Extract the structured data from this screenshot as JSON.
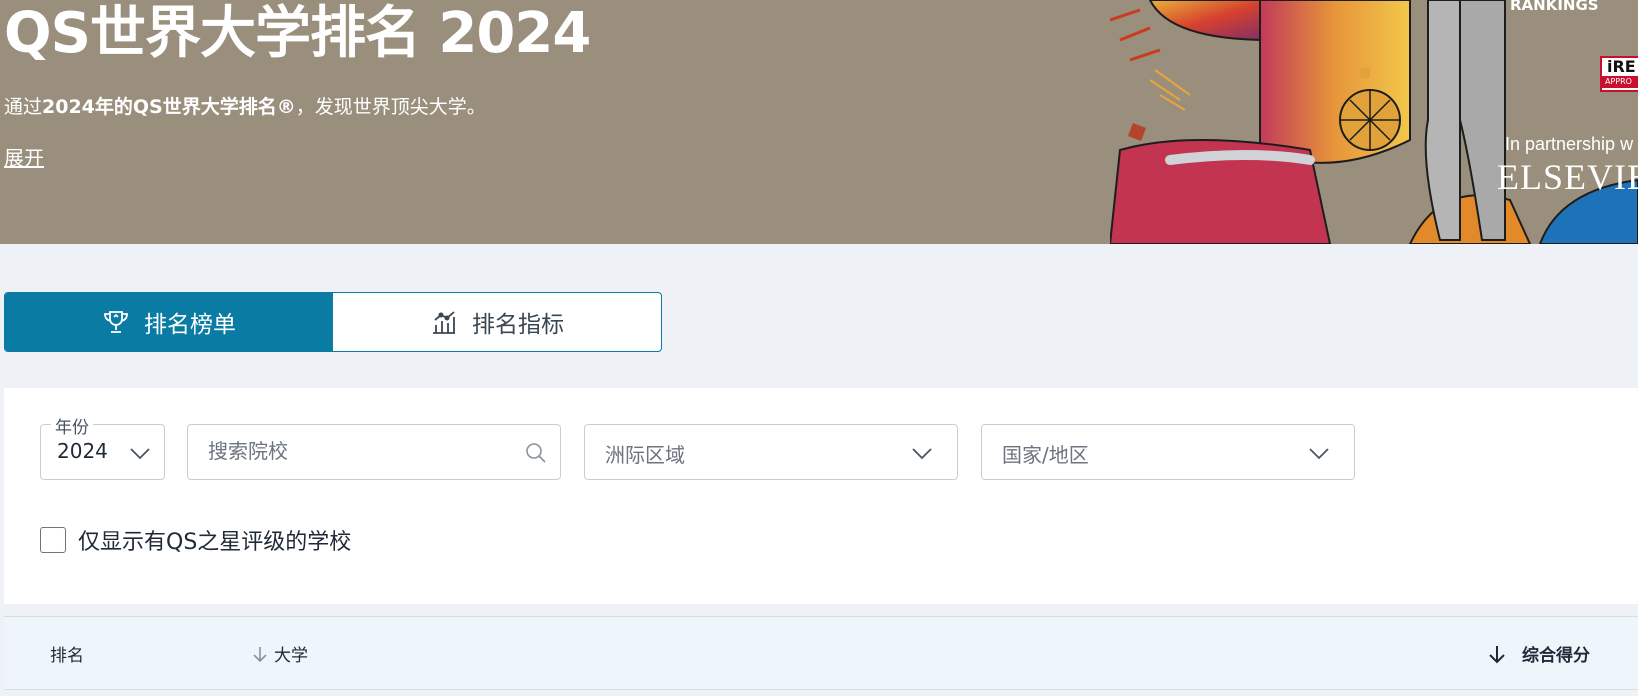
{
  "hero": {
    "title": "QS世界大学排名 2024",
    "subtitle_prefix": "通过",
    "subtitle_bold": "2024年的QS世界大学排名®",
    "subtitle_suffix": "，发现世界顶尖大学。",
    "expand_link": "展开",
    "rankings_badge": "RANKINGS",
    "partnership": "In partnership w",
    "partner_name": "ELSEVIE",
    "ireg_badge": "iRE",
    "ireg_sub": "APPRO"
  },
  "tabs": [
    {
      "label": "排名榜单",
      "icon": "trophy-icon",
      "active": true
    },
    {
      "label": "排名指标",
      "icon": "bar-chart-icon",
      "active": false
    }
  ],
  "filters": {
    "year_label": "年份",
    "year_value": "2024",
    "search_placeholder": "搜索院校",
    "region_placeholder": "洲际区域",
    "country_placeholder": "国家/地区",
    "stars_checkbox_label": "仅显示有QS之星评级的学校"
  },
  "table": {
    "headers": [
      "排名",
      "大学",
      "综合得分"
    ]
  },
  "colors": {
    "accent": "#0a7ba3",
    "hero_bg": "#9a8f7c",
    "page_bg": "#eef2f7",
    "table_head_bg": "#eef6fc"
  }
}
